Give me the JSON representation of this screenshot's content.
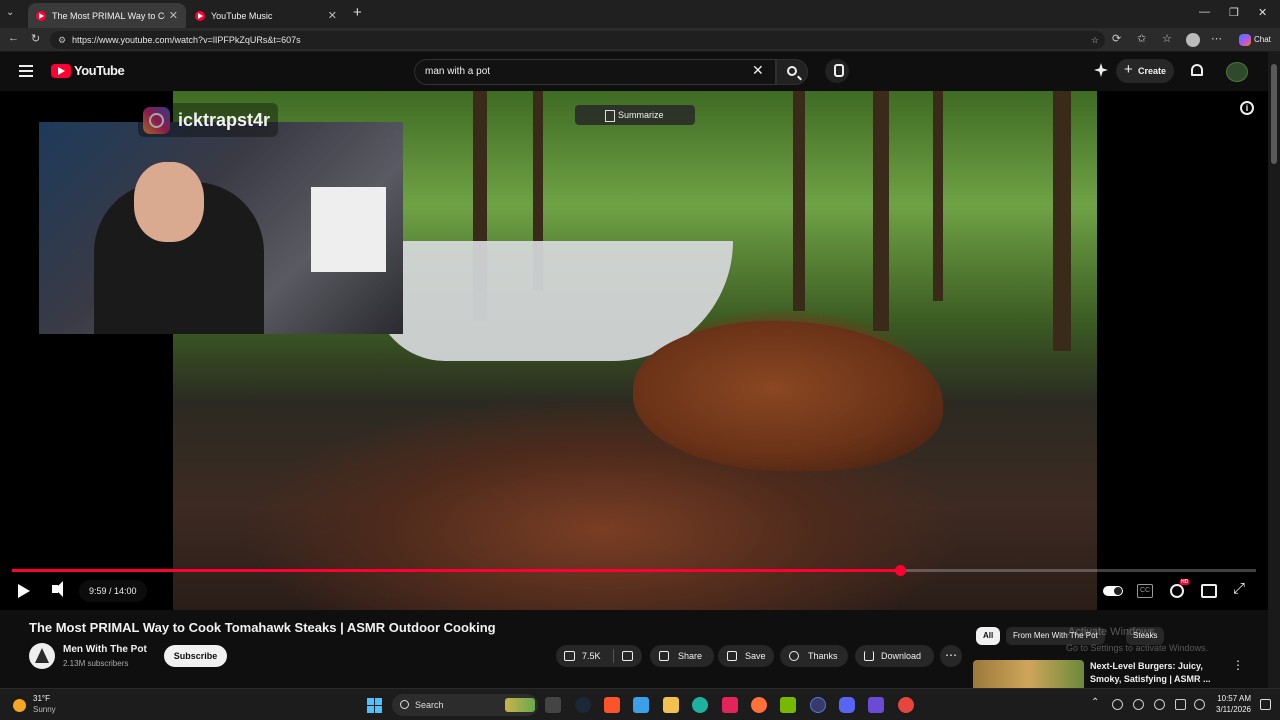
{
  "browser": {
    "tabs": [
      {
        "title": "The Most PRIMAL Way to Cook To",
        "active": true
      },
      {
        "title": "YouTube Music",
        "active": false
      }
    ],
    "new_tab_symbol": "+",
    "url": "https://www.youtube.com/watch?v=lIPFPkZqURs&t=607s",
    "chat_label": "Chat"
  },
  "youtube": {
    "logo_text": "YouTube",
    "search_value": "man with a pot",
    "create_label": "Create"
  },
  "player": {
    "overlay_handle": "icktrapst4r",
    "summarize_label": "Summarize",
    "info_symbol": "i",
    "time": "9:59 / 14:00",
    "progress": 0.714,
    "hd_badge": "HD",
    "cc_label": "CC"
  },
  "video": {
    "title": "The Most PRIMAL Way to Cook Tomahawk Steaks | ASMR Outdoor Cooking",
    "channel": "Men With The Pot",
    "subscribers": "2.13M subscribers",
    "subscribe_label": "Subscribe",
    "likes": "7.5K",
    "share_label": "Share",
    "save_label": "Save",
    "thanks_label": "Thanks",
    "download_label": "Download",
    "more_symbol": "⋯"
  },
  "sidebar": {
    "chips": [
      "All",
      "From Men With The Pot",
      "Steaks"
    ],
    "watermark_title": "Activate Windows",
    "watermark_sub": "Go to Settings to activate Windows.",
    "recommendation_title": "Next-Level Burgers: Juicy, Smoky, Satisfying | ASMR ...",
    "more_symbol": "⋮"
  },
  "taskbar": {
    "weather_temp": "31°F",
    "weather_cond": "Sunny",
    "search_placeholder": "Search",
    "time": "10:57 AM",
    "date": "3/11/2026"
  },
  "colors": {
    "brand_red": "#ff0033",
    "background": "#0f0f0f",
    "pill": "#272727"
  }
}
